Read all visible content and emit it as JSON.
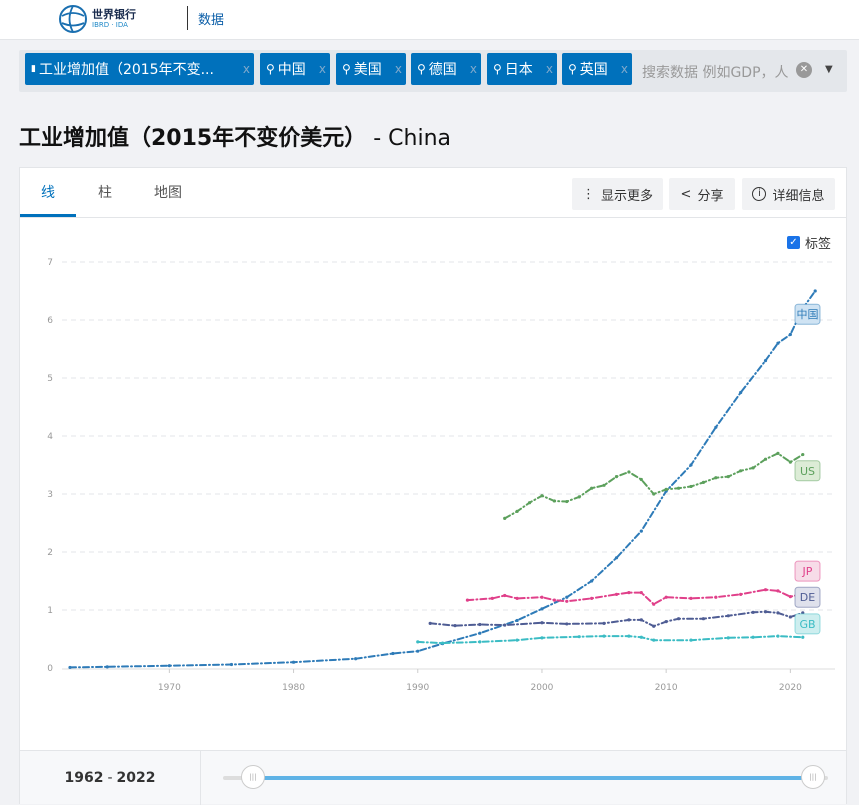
{
  "header": {
    "logo_title": "世界银行",
    "logo_sub": "IBRD · IDA",
    "section": "数据"
  },
  "filter": {
    "tags": [
      {
        "label": "工业增加值（2015年不变...",
        "icon": "bar-chart-icon"
      },
      {
        "label": "中国",
        "icon": "map-pin-icon"
      },
      {
        "label": "美国",
        "icon": "map-pin-icon"
      },
      {
        "label": "德国",
        "icon": "map-pin-icon"
      },
      {
        "label": "日本",
        "icon": "map-pin-icon"
      },
      {
        "label": "英国",
        "icon": "map-pin-icon"
      }
    ],
    "remove": "x",
    "placeholder": "搜索数据 例如GDP，人"
  },
  "page": {
    "title": "工业增加值（2015年不变价美元）",
    "country": " - China"
  },
  "tabs": [
    {
      "label": "线"
    },
    {
      "label": "柱"
    },
    {
      "label": "地图"
    }
  ],
  "actions": {
    "more": "显示更多",
    "share": "分享",
    "details": "详细信息"
  },
  "labels_toggle": {
    "label": "标签",
    "checked": true
  },
  "range": {
    "start": "1962",
    "sep": "-",
    "end": "2022"
  },
  "chart_data": {
    "type": "line",
    "xlim": [
      1962,
      2022
    ],
    "ylim": [
      0,
      7
    ],
    "xticks": [
      "1970",
      "1980",
      "1990",
      "2000",
      "2010",
      "2020"
    ],
    "yticks": [
      "0",
      "1",
      "2",
      "3",
      "4",
      "5",
      "6",
      "7"
    ],
    "grid": true,
    "series": [
      {
        "name": "中国",
        "color": "#2e7bb8",
        "label_bg": "#cfe3f3",
        "points": [
          [
            1962,
            0.01
          ],
          [
            1965,
            0.02
          ],
          [
            1970,
            0.04
          ],
          [
            1975,
            0.06
          ],
          [
            1980,
            0.1
          ],
          [
            1985,
            0.16
          ],
          [
            1988,
            0.25
          ],
          [
            1990,
            0.29
          ],
          [
            1992,
            0.42
          ],
          [
            1995,
            0.6
          ],
          [
            1998,
            0.82
          ],
          [
            2000,
            1.02
          ],
          [
            2002,
            1.22
          ],
          [
            2004,
            1.5
          ],
          [
            2006,
            1.9
          ],
          [
            2008,
            2.36
          ],
          [
            2010,
            3.05
          ],
          [
            2012,
            3.5
          ],
          [
            2014,
            4.15
          ],
          [
            2016,
            4.75
          ],
          [
            2018,
            5.3
          ],
          [
            2019,
            5.6
          ],
          [
            2020,
            5.75
          ],
          [
            2021,
            6.2
          ],
          [
            2022,
            6.5
          ]
        ]
      },
      {
        "name": "US",
        "color": "#5ca05c",
        "label_bg": "#dcecd6",
        "points": [
          [
            1997,
            2.58
          ],
          [
            1998,
            2.7
          ],
          [
            1999,
            2.85
          ],
          [
            2000,
            2.97
          ],
          [
            2001,
            2.88
          ],
          [
            2002,
            2.87
          ],
          [
            2003,
            2.95
          ],
          [
            2004,
            3.1
          ],
          [
            2005,
            3.15
          ],
          [
            2006,
            3.3
          ],
          [
            2007,
            3.38
          ],
          [
            2008,
            3.25
          ],
          [
            2009,
            3.0
          ],
          [
            2010,
            3.08
          ],
          [
            2011,
            3.1
          ],
          [
            2012,
            3.13
          ],
          [
            2013,
            3.2
          ],
          [
            2014,
            3.28
          ],
          [
            2015,
            3.3
          ],
          [
            2016,
            3.4
          ],
          [
            2017,
            3.45
          ],
          [
            2018,
            3.6
          ],
          [
            2019,
            3.7
          ],
          [
            2020,
            3.55
          ],
          [
            2021,
            3.68
          ]
        ]
      },
      {
        "name": "JP",
        "color": "#e0408a",
        "label_bg": "#f7dce8",
        "points": [
          [
            1994,
            1.17
          ],
          [
            1996,
            1.2
          ],
          [
            1997,
            1.25
          ],
          [
            1998,
            1.2
          ],
          [
            2000,
            1.22
          ],
          [
            2001,
            1.17
          ],
          [
            2002,
            1.15
          ],
          [
            2004,
            1.2
          ],
          [
            2006,
            1.27
          ],
          [
            2007,
            1.3
          ],
          [
            2008,
            1.3
          ],
          [
            2009,
            1.1
          ],
          [
            2010,
            1.22
          ],
          [
            2012,
            1.2
          ],
          [
            2014,
            1.22
          ],
          [
            2016,
            1.27
          ],
          [
            2018,
            1.35
          ],
          [
            2019,
            1.33
          ],
          [
            2020,
            1.23
          ],
          [
            2021,
            1.28
          ]
        ]
      },
      {
        "name": "DE",
        "color": "#4f5d94",
        "label_bg": "#dfe1ec",
        "points": [
          [
            1991,
            0.77
          ],
          [
            1993,
            0.73
          ],
          [
            1995,
            0.75
          ],
          [
            1997,
            0.74
          ],
          [
            2000,
            0.78
          ],
          [
            2002,
            0.76
          ],
          [
            2005,
            0.77
          ],
          [
            2007,
            0.83
          ],
          [
            2008,
            0.83
          ],
          [
            2009,
            0.72
          ],
          [
            2010,
            0.8
          ],
          [
            2011,
            0.85
          ],
          [
            2013,
            0.85
          ],
          [
            2015,
            0.9
          ],
          [
            2017,
            0.96
          ],
          [
            2018,
            0.97
          ],
          [
            2019,
            0.95
          ],
          [
            2020,
            0.88
          ],
          [
            2021,
            0.95
          ]
        ]
      },
      {
        "name": "GB",
        "color": "#3bbcc4",
        "label_bg": "#cdeeef",
        "points": [
          [
            1990,
            0.45
          ],
          [
            1992,
            0.43
          ],
          [
            1995,
            0.45
          ],
          [
            1998,
            0.48
          ],
          [
            2000,
            0.52
          ],
          [
            2003,
            0.54
          ],
          [
            2005,
            0.55
          ],
          [
            2007,
            0.55
          ],
          [
            2008,
            0.53
          ],
          [
            2009,
            0.48
          ],
          [
            2012,
            0.48
          ],
          [
            2015,
            0.52
          ],
          [
            2017,
            0.53
          ],
          [
            2019,
            0.55
          ],
          [
            2021,
            0.53
          ]
        ]
      }
    ]
  }
}
